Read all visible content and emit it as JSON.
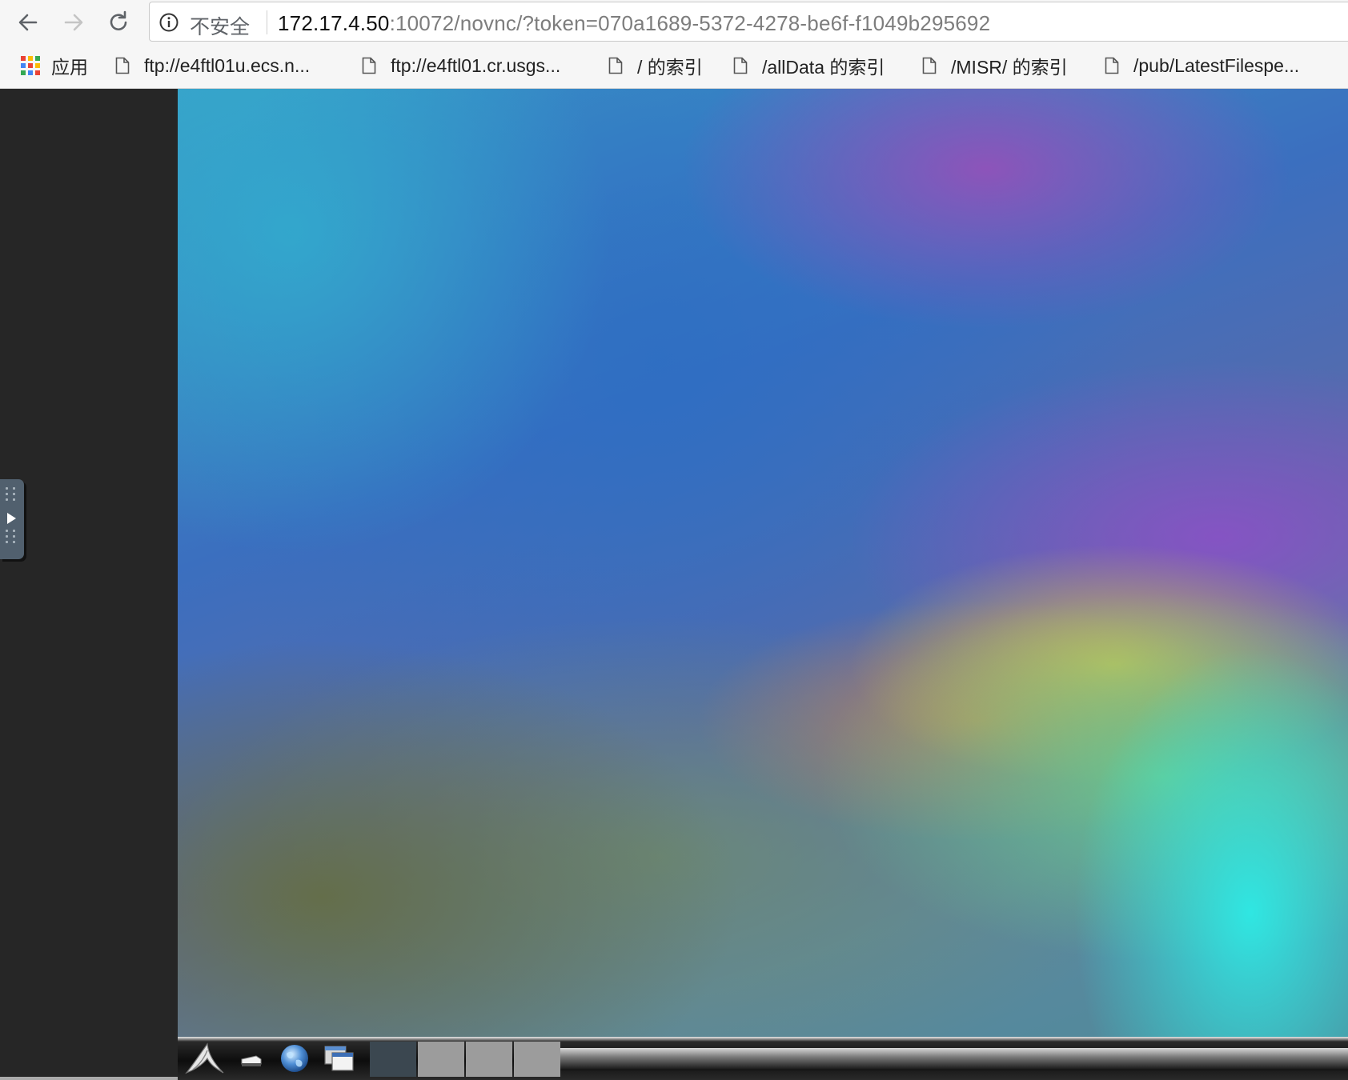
{
  "browser": {
    "security_label": "不安全",
    "url_host": "172.17.4.50",
    "url_rest": ":10072/novnc/?token=070a1689-5372-4278-be6f-f1049b295692"
  },
  "bookmarks": [
    {
      "label": "应用",
      "icon": "apps-grid-icon"
    },
    {
      "label": "ftp://e4ftl01u.ecs.n...",
      "icon": "page-icon"
    },
    {
      "label": "ftp://e4ftl01.cr.usgs...",
      "icon": "page-icon"
    },
    {
      "label": "/ 的索引",
      "icon": "page-icon"
    },
    {
      "label": "/allData 的索引",
      "icon": "page-icon"
    },
    {
      "label": "/MISR/ 的索引",
      "icon": "page-icon"
    },
    {
      "label": "/pub/LatestFilespe...",
      "icon": "page-icon"
    }
  ],
  "colors": {
    "apps_grid": [
      "#ea4335",
      "#fbbc05",
      "#34a853",
      "#4285f4",
      "#ea4335",
      "#fbbc05",
      "#34a853",
      "#4285f4",
      "#ea4335"
    ],
    "control_handle": "#51606e",
    "sidebar_bg": "#262626"
  },
  "taskbar": {
    "items": [
      {
        "icon": "lxde-logo-icon"
      },
      {
        "icon": "minimize-all-icon"
      },
      {
        "icon": "web-browser-icon"
      },
      {
        "icon": "window-switch-icon"
      }
    ],
    "desktops": [
      {
        "state": "active"
      },
      {
        "state": "inactive"
      },
      {
        "state": "inactive"
      },
      {
        "state": "inactive"
      }
    ]
  }
}
